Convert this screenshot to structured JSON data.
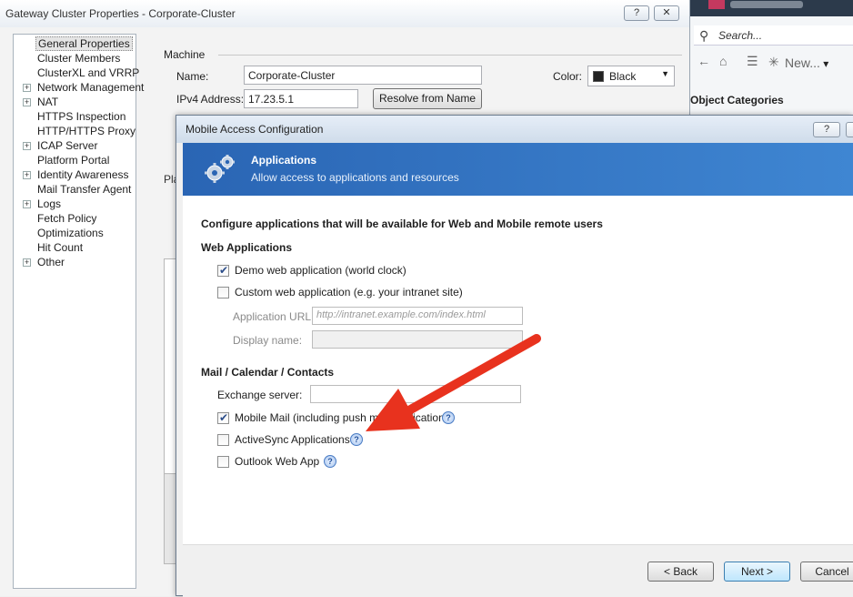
{
  "bg_window": {
    "title": "Gateway Cluster Properties - Corporate-Cluster",
    "help_glyph": "?",
    "close_glyph": "✕",
    "tree": [
      {
        "label": "General Properties",
        "expandable": false,
        "selected": true
      },
      {
        "label": "Cluster Members",
        "expandable": false
      },
      {
        "label": "ClusterXL and VRRP",
        "expandable": false
      },
      {
        "label": "Network Management",
        "expandable": true
      },
      {
        "label": "NAT",
        "expandable": true
      },
      {
        "label": "HTTPS Inspection",
        "expandable": false
      },
      {
        "label": "HTTP/HTTPS Proxy",
        "expandable": false
      },
      {
        "label": "ICAP Server",
        "expandable": true
      },
      {
        "label": "Platform Portal",
        "expandable": false
      },
      {
        "label": "Identity Awareness",
        "expandable": true
      },
      {
        "label": "Mail Transfer Agent",
        "expandable": false
      },
      {
        "label": "Logs",
        "expandable": true
      },
      {
        "label": "Fetch Policy",
        "expandable": false
      },
      {
        "label": "Optimizations",
        "expandable": false
      },
      {
        "label": "Hit Count",
        "expandable": false
      },
      {
        "label": "Other",
        "expandable": true
      }
    ],
    "machine_group": "Machine",
    "name_label": "Name:",
    "name_value": "Corporate-Cluster",
    "color_label": "Color:",
    "color_value": "Black",
    "ipv4_label": "IPv4 Address:",
    "ipv4_value": "17.23.5.1",
    "resolve_button": "Resolve from Name",
    "partial_label": "Pla"
  },
  "right_app": {
    "search_placeholder": "Search...",
    "new_button": "New...",
    "categories_title": "Object Categories"
  },
  "dialog": {
    "title": "Mobile Access Configuration",
    "help_glyph": "?",
    "banner_title": "Applications",
    "banner_subtitle": "Allow access to applications and resources",
    "heading": "Configure applications that will be available for Web and Mobile remote users",
    "web_section": "Web Applications",
    "demo_app": {
      "label": "Demo web application (world clock)",
      "checked": true
    },
    "custom_app": {
      "label": "Custom web application (e.g. your intranet site)",
      "checked": false
    },
    "app_url_label": "Application URL:",
    "app_url_placeholder": "http://intranet.example.com/index.html",
    "display_name_label": "Display name:",
    "mail_section": "Mail / Calendar / Contacts",
    "exchange_label": "Exchange server:",
    "mobile_mail": {
      "label": "Mobile Mail (including push mail notifications)",
      "checked": true
    },
    "activesync": {
      "label": "ActiveSync Applications",
      "checked": false
    },
    "outlook": {
      "label": "Outlook Web App",
      "checked": false
    },
    "help_icon_glyph": "?",
    "back_button": "< Back",
    "next_button": "Next >",
    "cancel_button": "Cancel"
  },
  "colors": {
    "banner": "#2a65b4",
    "arrow": "#e8321e",
    "selection": "#e5e5e5"
  }
}
